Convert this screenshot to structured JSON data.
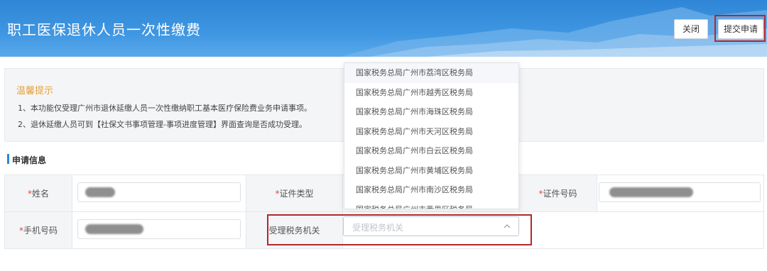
{
  "header": {
    "title": "职工医保退休人员一次性缴费",
    "close_label": "关闭",
    "submit_label": "提交申请"
  },
  "notice": {
    "title": "温馨提示",
    "lines": [
      "1、本功能仅受理广州市退休延缴人员一次性缴纳职工基本医疗保险费业务申请事项。",
      "2、退休延缴人员可到【社保文书事项管理-事项进度管理】界面查询是否成功受理。"
    ]
  },
  "section": {
    "title": "申请信息"
  },
  "form": {
    "required_mark": "*",
    "labels": {
      "name": "姓名",
      "id_type": "证件类型",
      "id_number": "证件号码",
      "phone": "手机号码",
      "tax_office": "受理税务机关"
    },
    "tax_office_placeholder": "受理税务机关"
  },
  "dropdown": {
    "options": [
      "国家税务总局广州市荔湾区税务局",
      "国家税务总局广州市越秀区税务局",
      "国家税务总局广州市海珠区税务局",
      "国家税务总局广州市天河区税务局",
      "国家税务总局广州市白云区税务局",
      "国家税务总局广州市黄埔区税务局",
      "国家税务总局广州市南沙区税务局",
      "国家税务总局广州市番禺区税务局"
    ]
  },
  "icons": {
    "select_arrow": "chevron-up-icon"
  },
  "colors": {
    "header": "#2f86d6",
    "highlight": "#b3282d",
    "notice_title": "#e6a23c",
    "required": "#e04a3c"
  }
}
